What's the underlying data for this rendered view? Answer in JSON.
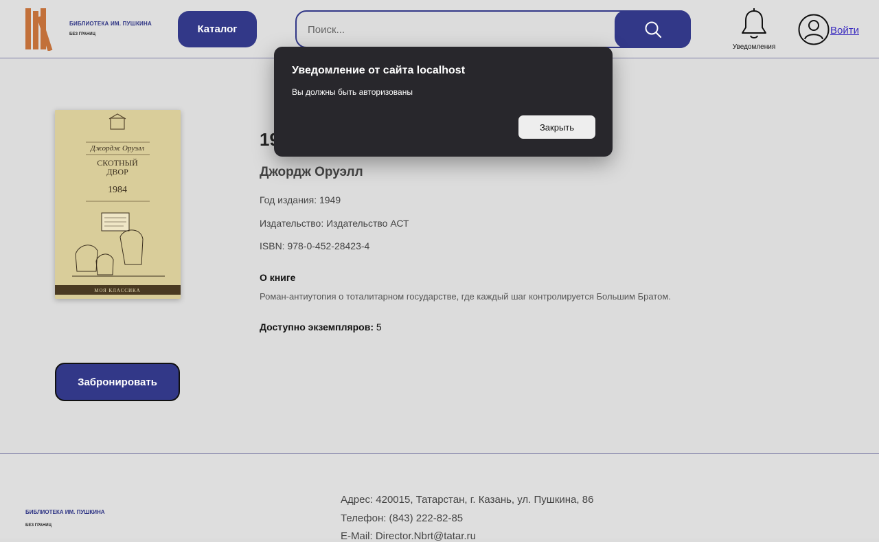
{
  "header": {
    "logo_title": "БИБЛИОТЕКА ИМ. ПУШКИНА",
    "logo_subtitle": "БЕЗ ГРАНИЦ",
    "catalog_label": "Каталог",
    "search_placeholder": "Поиск...",
    "notifications_label": "Уведомления",
    "login_label": "Войти"
  },
  "book": {
    "title": "1984",
    "author": "Джордж Оруэлл",
    "year": "Год издания: 1949",
    "publisher": "Издательство: Издательство АСТ",
    "isbn": "ISBN: 978-0-452-28423-4",
    "about_heading": "О книге",
    "about_text": "Роман-антиутопия о тоталитарном государстве, где каждый шаг контролируется Большим Братом.",
    "available_label": "Доступно экземпляров:",
    "available_count": "5",
    "reserve_label": "Забронировать",
    "cover": {
      "author": "Джордж Оруэлл",
      "title_line1": "СКОТНЫЙ",
      "title_line2": "ДВОР",
      "title_line3": "1984",
      "series": "МОЯ КЛАССИКА"
    }
  },
  "footer": {
    "logo_title": "БИБЛИОТЕКА ИМ. ПУШКИНА",
    "logo_subtitle": "БЕЗ ГРАНИЦ",
    "address": "Адрес: 420015, Татарстан, г. Казань, ул. Пушкина, 86",
    "phone": "Телефон: (843) 222-82-85",
    "email": "E-Mail: Director.Nbrt@tatar.ru"
  },
  "dialog": {
    "title": "Уведомление от сайта localhost",
    "message": "Вы должны быть авторизованы",
    "close_label": "Закрыть"
  },
  "colors": {
    "accent": "#323888",
    "logo_books": "#c2703a",
    "background": "#dcdcdc",
    "dialog_bg": "#28272c"
  }
}
